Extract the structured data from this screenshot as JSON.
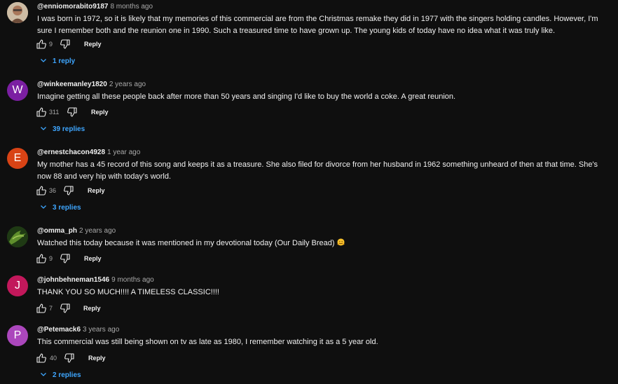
{
  "comments": [
    {
      "handle": "@enniomorabito9187",
      "time": "8 months ago",
      "avatar": {
        "type": "photo",
        "letter": ""
      },
      "text": "I was born in 1972, so it is likely that my memories of this commercial are from the Christmas remake they did in 1977 with the singers holding candles. However, I'm sure I remember both and the reunion one in 1990. Such a treasured time to have grown up. The young kids of today have no idea what it was truly like.",
      "likes": "9",
      "reply_label": "Reply",
      "replies": "1 reply"
    },
    {
      "handle": "@winkeemanley1820",
      "time": "2 years ago",
      "avatar": {
        "type": "letter",
        "letter": "W",
        "color": "#7b1fa2"
      },
      "text": "Imagine getting all these people back after more than 50 years and singing  I'd like to buy the world a coke. A great reunion.",
      "likes": "311",
      "reply_label": "Reply",
      "replies": "39 replies"
    },
    {
      "handle": "@ernestchacon4928",
      "time": "1 year ago",
      "avatar": {
        "type": "letter",
        "letter": "E",
        "color": "#d84315"
      },
      "text": "My mother has a 45 record of this song and keeps it as a treasure. She also filed for divorce from her husband in 1962 something unheard of then at that time. She's now 88 and very hip with today's world.",
      "likes": "36",
      "reply_label": "Reply",
      "replies": "3 replies"
    },
    {
      "handle": "@omma_ph",
      "time": "2 years ago",
      "avatar": {
        "type": "green",
        "letter": ""
      },
      "text": "Watched this today because it was mentioned in my devotional today (Our Daily Bread)",
      "emoji": "hugging-face",
      "likes": "9",
      "reply_label": "Reply",
      "replies": ""
    },
    {
      "handle": "@johnbehneman1546",
      "time": "9 months ago",
      "avatar": {
        "type": "letter",
        "letter": "J",
        "color": "#c2185b"
      },
      "text": "THANK YOU SO MUCH!!!!   A TIMELESS CLASSIC!!!!",
      "likes": "7",
      "reply_label": "Reply",
      "replies": ""
    },
    {
      "handle": "@Petemack6",
      "time": "3 years ago",
      "avatar": {
        "type": "letter",
        "letter": "P",
        "color": "#ab47bc"
      },
      "text": "This commercial was still being shown on tv as late as 1980, I remember watching it as a 5 year old.",
      "likes": "40",
      "reply_label": "Reply",
      "replies": "2 replies"
    }
  ],
  "colors": {
    "background": "#0f0f0f",
    "link": "#3ea6ff",
    "muted": "#aaaaaa",
    "text": "#f1f1f1"
  }
}
